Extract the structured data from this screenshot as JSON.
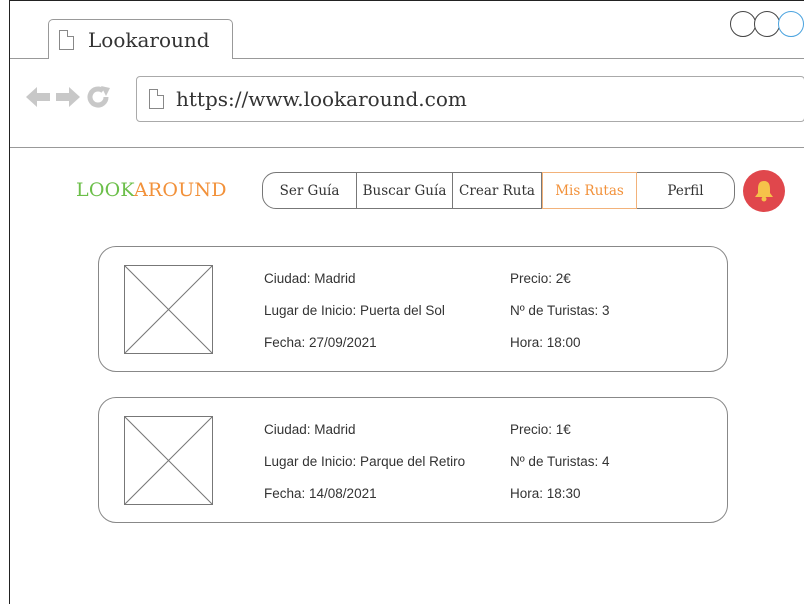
{
  "browser": {
    "tab_title": "Lookaround",
    "url": "https://www.lookaround.com"
  },
  "logo": {
    "part1": "LOOK",
    "part2": "AROUND"
  },
  "menu": {
    "items": [
      {
        "label": "Ser Guía"
      },
      {
        "label": "Buscar Guía"
      },
      {
        "label": "Crear Ruta"
      },
      {
        "label": "Mis Rutas"
      },
      {
        "label": "Perfil"
      }
    ],
    "active": "Mis Rutas"
  },
  "colors": {
    "logo_look": "#6cbf4a",
    "logo_around": "#f2913a",
    "active_item": "#f2913a",
    "bell": "#e0474c"
  },
  "routes": [
    {
      "ciudad": "Ciudad: Madrid",
      "lugar": "Lugar de Inicio: Puerta del Sol",
      "fecha": "Fecha: 27/09/2021",
      "precio": "Precio: 2€",
      "turistas": "Nº de Turistas: 3",
      "hora": "Hora: 18:00"
    },
    {
      "ciudad": "Ciudad: Madrid",
      "lugar": "Lugar de Inicio: Parque del Retiro",
      "fecha": "Fecha: 14/08/2021",
      "precio": "Precio: 1€",
      "turistas": "Nº de Turistas: 4",
      "hora": "Hora: 18:30"
    }
  ]
}
